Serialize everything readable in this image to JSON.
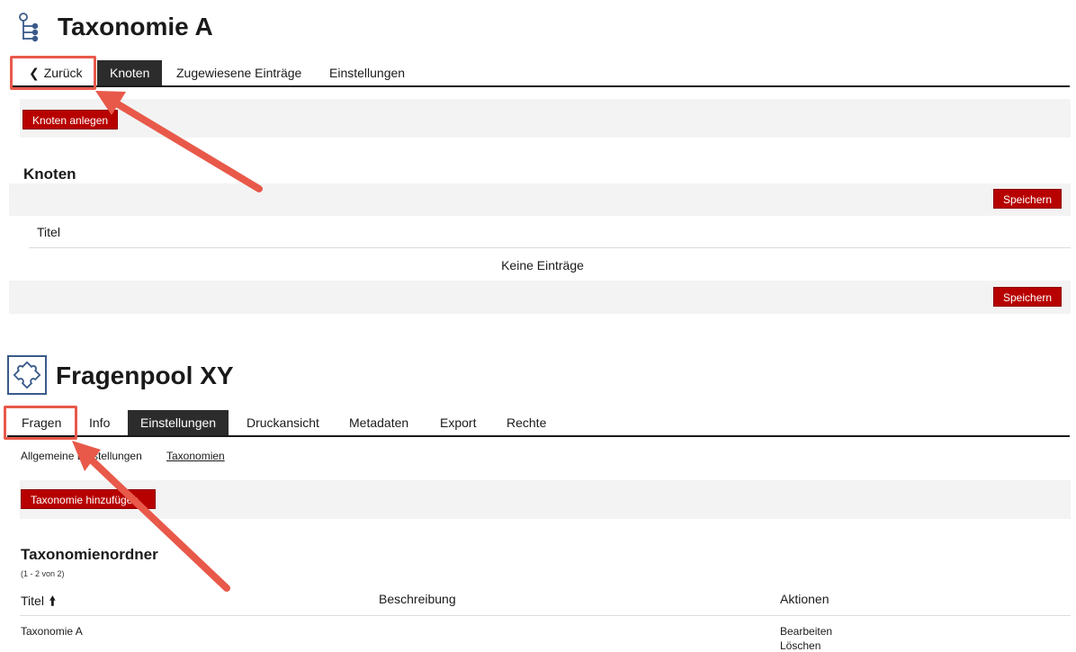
{
  "section1": {
    "title": "Taxonomie A",
    "icon": "taxonomy-tree-icon",
    "tabs": {
      "back_label": "Zurück",
      "items": [
        {
          "label": "Knoten",
          "active": true
        },
        {
          "label": "Zugewiesene Einträge",
          "active": false
        },
        {
          "label": "Einstellungen",
          "active": false
        }
      ]
    },
    "create_button": "Knoten anlegen",
    "table": {
      "heading": "Knoten",
      "save_label": "Speichern",
      "column": "Titel",
      "empty": "Keine Einträge"
    }
  },
  "section2": {
    "title": "Fragenpool XY",
    "icon": "puzzle-icon",
    "tabs": [
      {
        "label": "Fragen",
        "active": false
      },
      {
        "label": "Info",
        "active": false
      },
      {
        "label": "Einstellungen",
        "active": true
      },
      {
        "label": "Druckansicht",
        "active": false
      },
      {
        "label": "Metadaten",
        "active": false
      },
      {
        "label": "Export",
        "active": false
      },
      {
        "label": "Rechte",
        "active": false
      }
    ],
    "subtabs": [
      {
        "label": "Allgemeine Einstellungen",
        "active": false
      },
      {
        "label": "Taxonomien",
        "active": true
      }
    ],
    "add_button": "Taxonomie hinzufügen",
    "table": {
      "heading": "Taxonomienordner",
      "count": "(1 - 2 von 2)",
      "columns": [
        "Titel",
        "Beschreibung",
        "Aktionen"
      ],
      "rows": [
        {
          "title": "Taxonomie A",
          "description": "",
          "actions": [
            "Bearbeiten",
            "Löschen"
          ]
        }
      ]
    }
  },
  "annotations": {
    "highlight_color": "#e8594a",
    "arrow_color": "#e8594a"
  }
}
